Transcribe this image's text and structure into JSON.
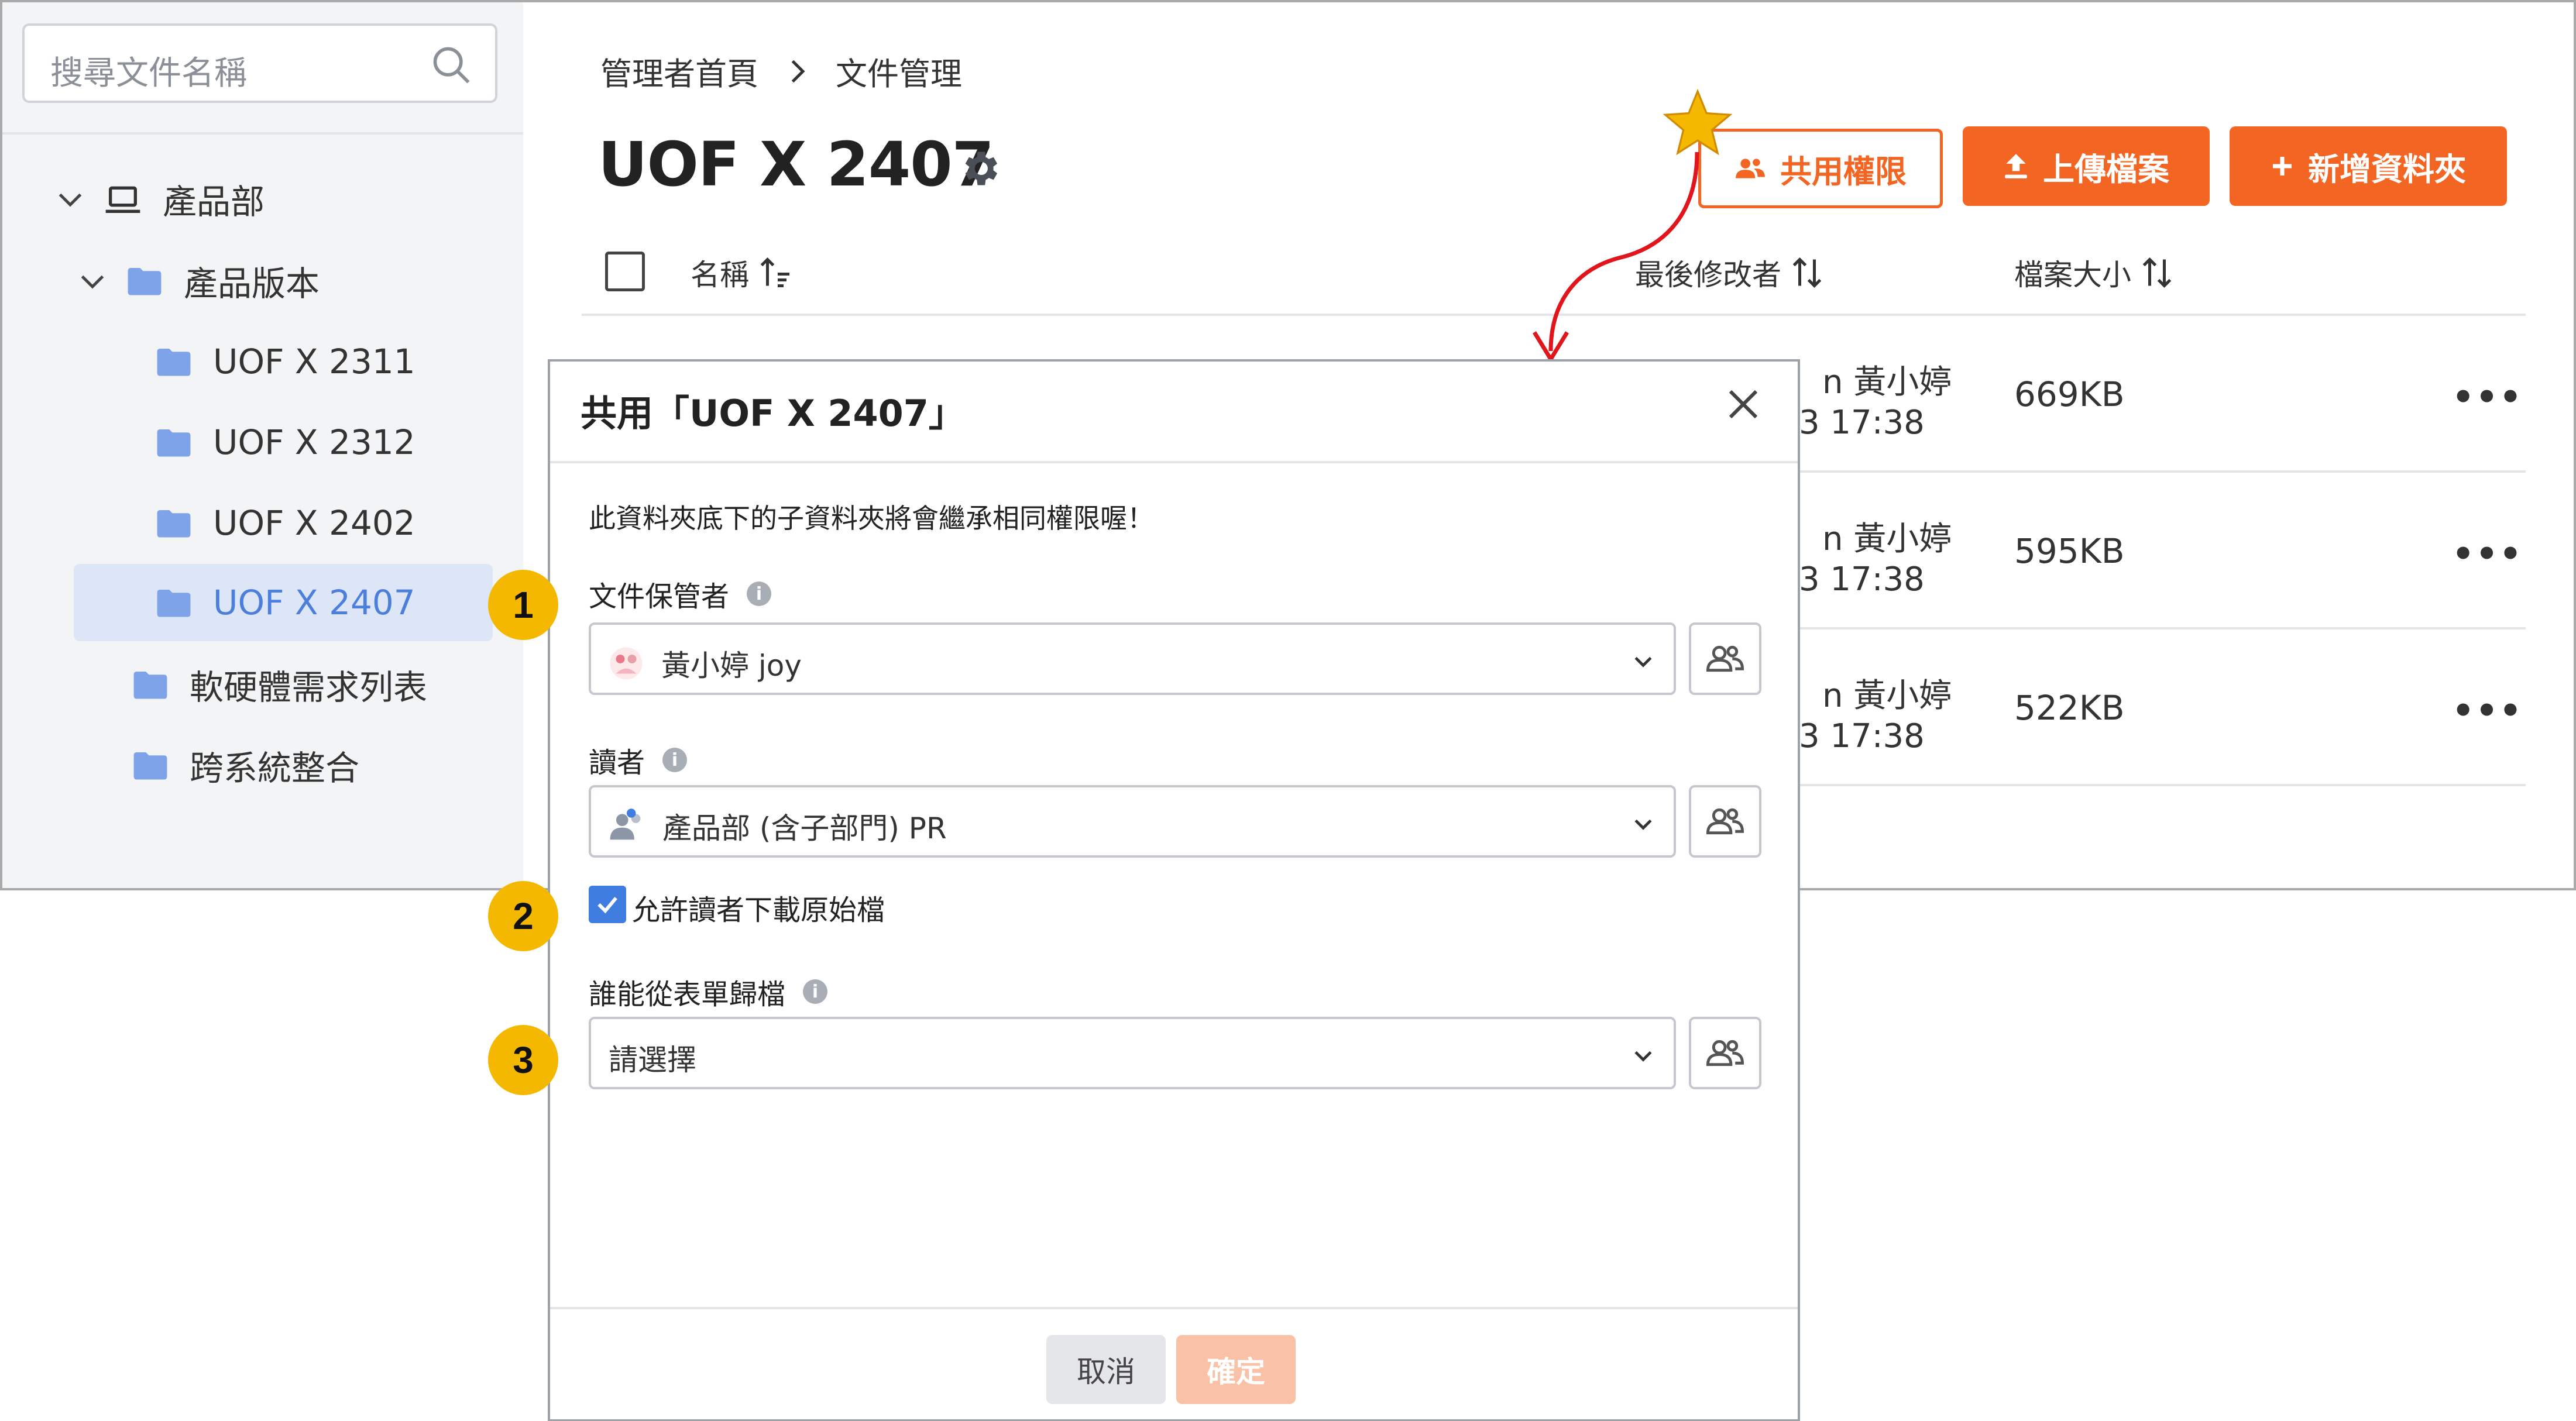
{
  "sidebar": {
    "search_placeholder": "搜尋文件名稱",
    "tree": [
      {
        "label": "產品部",
        "type": "dept",
        "expanded": true
      },
      {
        "label": "產品版本",
        "type": "folder",
        "expanded": true
      },
      {
        "label": "UOF X 2311",
        "type": "folder"
      },
      {
        "label": "UOF X 2312",
        "type": "folder"
      },
      {
        "label": "UOF X 2402",
        "type": "folder"
      },
      {
        "label": "UOF X 2407",
        "type": "folder",
        "active": true
      },
      {
        "label": "軟硬體需求列表",
        "type": "folder"
      },
      {
        "label": "跨系統整合",
        "type": "folder"
      }
    ]
  },
  "breadcrumb": {
    "home": "管理者首頁",
    "current": "文件管理"
  },
  "page": {
    "title": "UOF X 2407"
  },
  "toolbar": {
    "share_label": "共用權限",
    "upload_label": "上傳檔案",
    "newfolder_label": "新增資料夾"
  },
  "table": {
    "columns": {
      "name": "名稱",
      "modifier": "最後修改者",
      "size": "檔案大小"
    },
    "rows": [
      {
        "modifier": "n 黃小婷",
        "time": "3 17:38",
        "size": "669KB",
        "more": "•••"
      },
      {
        "modifier": "n 黃小婷",
        "time": "3 17:38",
        "size": "595KB",
        "more": "•••"
      },
      {
        "modifier": "n 黃小婷",
        "time": "3 17:38",
        "size": "522KB",
        "more": "•••"
      }
    ]
  },
  "dialog": {
    "title": "共用「UOF X 2407」",
    "notice": "此資料夾底下的子資料夾將會繼承相同權限喔！",
    "custodian_label": "文件保管者",
    "custodian_value": "黃小婷  joy",
    "reader_label": "讀者",
    "reader_value": "產品部 (含子部門) PR",
    "allow_download_label": "允許讀者下載原始檔",
    "allow_download_checked": true,
    "archive_label": "誰能從表單歸檔",
    "archive_value": "請選擇",
    "info_glyph": "i",
    "cancel_label": "取消",
    "confirm_label": "確定"
  },
  "callouts": [
    "1",
    "2",
    "3"
  ],
  "colors": {
    "accent": "#f26522",
    "active_blue": "#4b7fdb",
    "folder": "#7fa3e8",
    "step": "#f5b800",
    "arrow": "#e0161c"
  }
}
